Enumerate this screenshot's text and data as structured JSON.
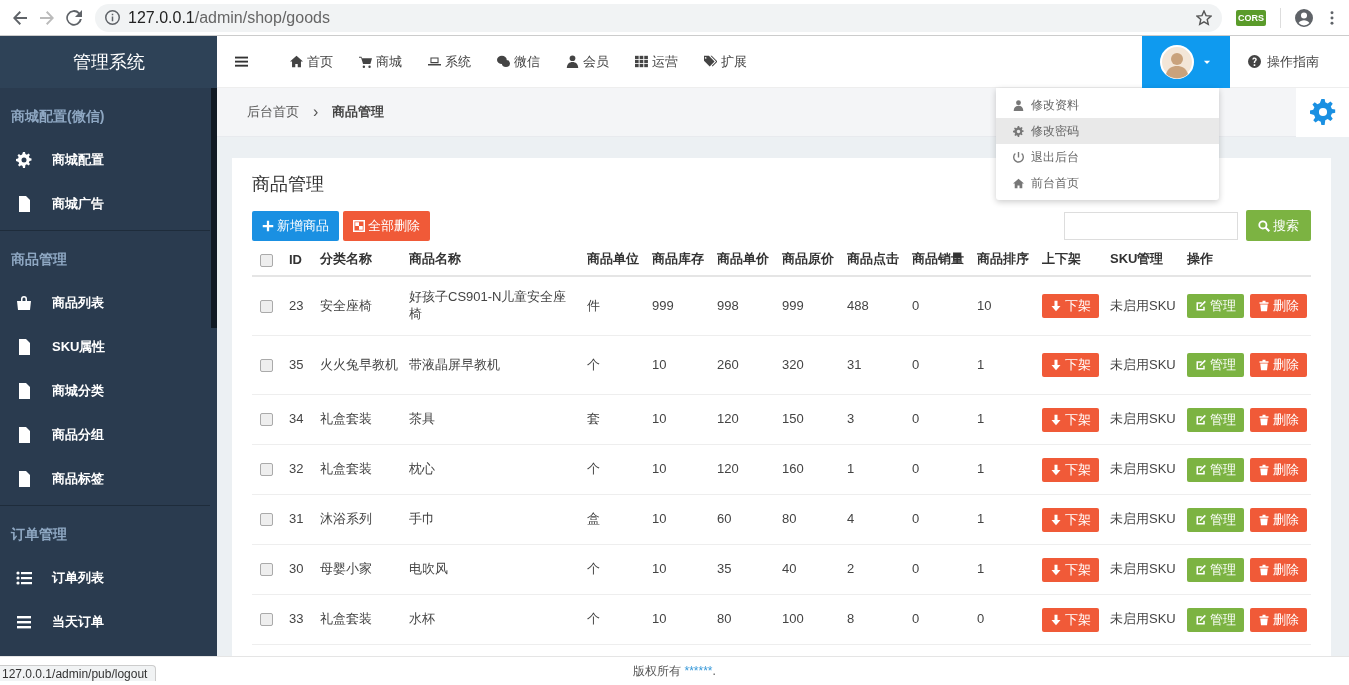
{
  "browser": {
    "url_host": "127.0.0.1",
    "url_path": "/admin/shop/goods",
    "forward_disabled": true,
    "extension": "CORS"
  },
  "sidebar": {
    "brand": "管理系统",
    "groups": [
      {
        "title": "商城配置(微信)",
        "items": [
          {
            "label": "商城配置",
            "kind": "gear"
          },
          {
            "label": "商城广告",
            "kind": "file"
          }
        ]
      },
      {
        "title": "商品管理",
        "items": [
          {
            "label": "商品列表",
            "kind": "bag"
          },
          {
            "label": "SKU属性",
            "kind": "file"
          },
          {
            "label": "商城分类",
            "kind": "file"
          },
          {
            "label": "商品分组",
            "kind": "file"
          },
          {
            "label": "商品标签",
            "kind": "file"
          }
        ]
      },
      {
        "title": "订单管理",
        "items": [
          {
            "label": "订单列表",
            "kind": "list"
          },
          {
            "label": "当天订单",
            "kind": "bars"
          }
        ]
      }
    ]
  },
  "topnav": {
    "items": [
      {
        "label": "首页",
        "kind": "home"
      },
      {
        "label": "商城",
        "kind": "cart"
      },
      {
        "label": "系统",
        "kind": "laptop"
      },
      {
        "label": "微信",
        "kind": "wechat"
      },
      {
        "label": "会员",
        "kind": "user"
      },
      {
        "label": "运营",
        "kind": "grid"
      },
      {
        "label": "扩展",
        "kind": "tags"
      }
    ],
    "guide": "操作指南",
    "user_menu": [
      {
        "label": "修改资料",
        "kind": "user",
        "selected": false
      },
      {
        "label": "修改密码",
        "kind": "gear",
        "selected": true
      },
      {
        "label": "退出后台",
        "kind": "power",
        "selected": false
      },
      {
        "label": "前台首页",
        "kind": "home",
        "selected": false
      }
    ]
  },
  "breadcrumb": {
    "items": [
      "后台首页",
      "商品管理"
    ],
    "separator": "›"
  },
  "panel": {
    "title": "商品管理",
    "add_button": "新增商品",
    "delete_all_button": "全部删除",
    "search_button": "搜索"
  },
  "table": {
    "select_all_checked": false,
    "columns": [
      "ID",
      "分类名称",
      "商品名称",
      "商品单位",
      "商品库存",
      "商品单价",
      "商品原价",
      "商品点击",
      "商品销量",
      "商品排序",
      "上下架",
      "SKU管理",
      "操作"
    ],
    "rows": [
      {
        "checked": false,
        "cells": [
          "23",
          "安全座椅",
          "好孩子CS901-N儿童安全座椅",
          "件",
          "999",
          "998",
          "999",
          "488",
          "0",
          "10"
        ],
        "shelf": "下架",
        "sku": "未启用SKU",
        "manage": "管理",
        "delete": "删除"
      },
      {
        "checked": false,
        "cells": [
          "35",
          "火火兔早教机",
          "带液晶屏早教机",
          "个",
          "10",
          "260",
          "320",
          "31",
          "0",
          "1"
        ],
        "shelf": "下架",
        "sku": "未启用SKU",
        "manage": "管理",
        "delete": "删除"
      },
      {
        "checked": false,
        "cells": [
          "34",
          "礼盒套装",
          "茶具",
          "套",
          "10",
          "120",
          "150",
          "3",
          "0",
          "1"
        ],
        "shelf": "下架",
        "sku": "未启用SKU",
        "manage": "管理",
        "delete": "删除"
      },
      {
        "checked": false,
        "cells": [
          "32",
          "礼盒套装",
          "枕心",
          "个",
          "10",
          "120",
          "160",
          "1",
          "0",
          "1"
        ],
        "shelf": "下架",
        "sku": "未启用SKU",
        "manage": "管理",
        "delete": "删除"
      },
      {
        "checked": false,
        "cells": [
          "31",
          "沐浴系列",
          "手巾",
          "盒",
          "10",
          "60",
          "80",
          "4",
          "0",
          "1"
        ],
        "shelf": "下架",
        "sku": "未启用SKU",
        "manage": "管理",
        "delete": "删除"
      },
      {
        "checked": false,
        "cells": [
          "30",
          "母婴小家",
          "电吹风",
          "个",
          "10",
          "35",
          "40",
          "2",
          "0",
          "1"
        ],
        "shelf": "下架",
        "sku": "未启用SKU",
        "manage": "管理",
        "delete": "删除"
      },
      {
        "checked": false,
        "cells": [
          "33",
          "礼盒套装",
          "水杯",
          "个",
          "10",
          "80",
          "100",
          "8",
          "0",
          "0"
        ],
        "shelf": "下架",
        "sku": "未启用SKU",
        "manage": "管理",
        "delete": "删除"
      }
    ]
  },
  "footer": {
    "text": "版权所有",
    "link": "******",
    "suffix": "."
  },
  "status_url": "127.0.0.1/admin/pub/logout"
}
